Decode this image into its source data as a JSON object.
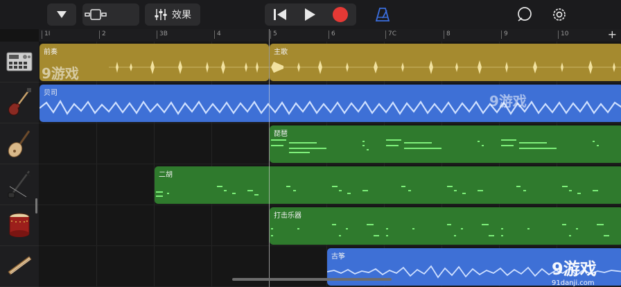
{
  "toolbar": {
    "fx_label": "效果"
  },
  "ruler": {
    "ticks": [
      "1I",
      "2",
      "3B",
      "4",
      "5",
      "6",
      "7C",
      "8",
      "9",
      "10"
    ],
    "add_symbol": "+"
  },
  "tracks": [
    {
      "instrument_icon": "drum-machine-icon"
    },
    {
      "instrument_icon": "bass-guitar-icon"
    },
    {
      "instrument_icon": "pipa-icon"
    },
    {
      "instrument_icon": "erhu-icon"
    },
    {
      "instrument_icon": "drum-icon"
    },
    {
      "instrument_icon": "guzheng-icon"
    }
  ],
  "regions": {
    "intro": "前奏",
    "verse": "主歌",
    "bass": "贝司",
    "pipa": "琵琶",
    "erhu": "二胡",
    "percussion": "打击乐器",
    "guzheng": "古筝"
  },
  "watermark": {
    "brand": "游戏",
    "num": "9",
    "site": "91danji.com"
  },
  "colors": {
    "gold": "#a58a2f",
    "blue": "#3e70d6",
    "green": "#2f7a2d",
    "record": "#e53935",
    "metronome": "#3b6fe0"
  }
}
